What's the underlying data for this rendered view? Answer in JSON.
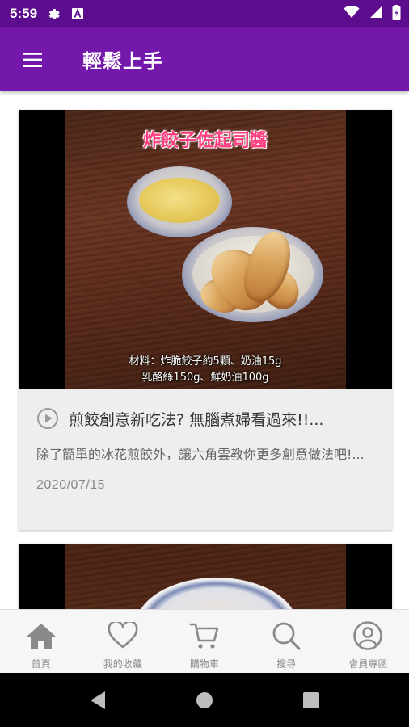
{
  "status_bar": {
    "time": "5:59",
    "icons": [
      "gear-icon",
      "font-icon",
      "wifi-icon",
      "signal-icon",
      "battery-icon"
    ]
  },
  "app_bar": {
    "title": "輕鬆上手",
    "menu_icon": "hamburger-menu-icon"
  },
  "cards": [
    {
      "image_title": "炸餃子佐起司醬",
      "image_ingredients_line1": "材料：炸脆餃子約5顆、奶油15g",
      "image_ingredients_line2": "乳酪絲150g、鮮奶油100g",
      "title": "煎餃創意新吃法? 無腦煮婦看過來!!...",
      "description": "除了簡單的冰花煎餃外，讓六角雲教你更多創意做法吧!...",
      "date": "2020/07/15"
    }
  ],
  "bottom_nav": {
    "items": [
      {
        "label": "首頁",
        "icon": "home-icon"
      },
      {
        "label": "我的收藏",
        "icon": "heart-icon"
      },
      {
        "label": "購物車",
        "icon": "cart-icon"
      },
      {
        "label": "搜尋",
        "icon": "search-icon"
      },
      {
        "label": "會員專區",
        "icon": "user-icon"
      }
    ]
  },
  "colors": {
    "status_bar": "#5c0d8e",
    "app_bar": "#7417ab",
    "card_bg": "#eeeeee",
    "nav_icon": "#8a8a8a"
  }
}
